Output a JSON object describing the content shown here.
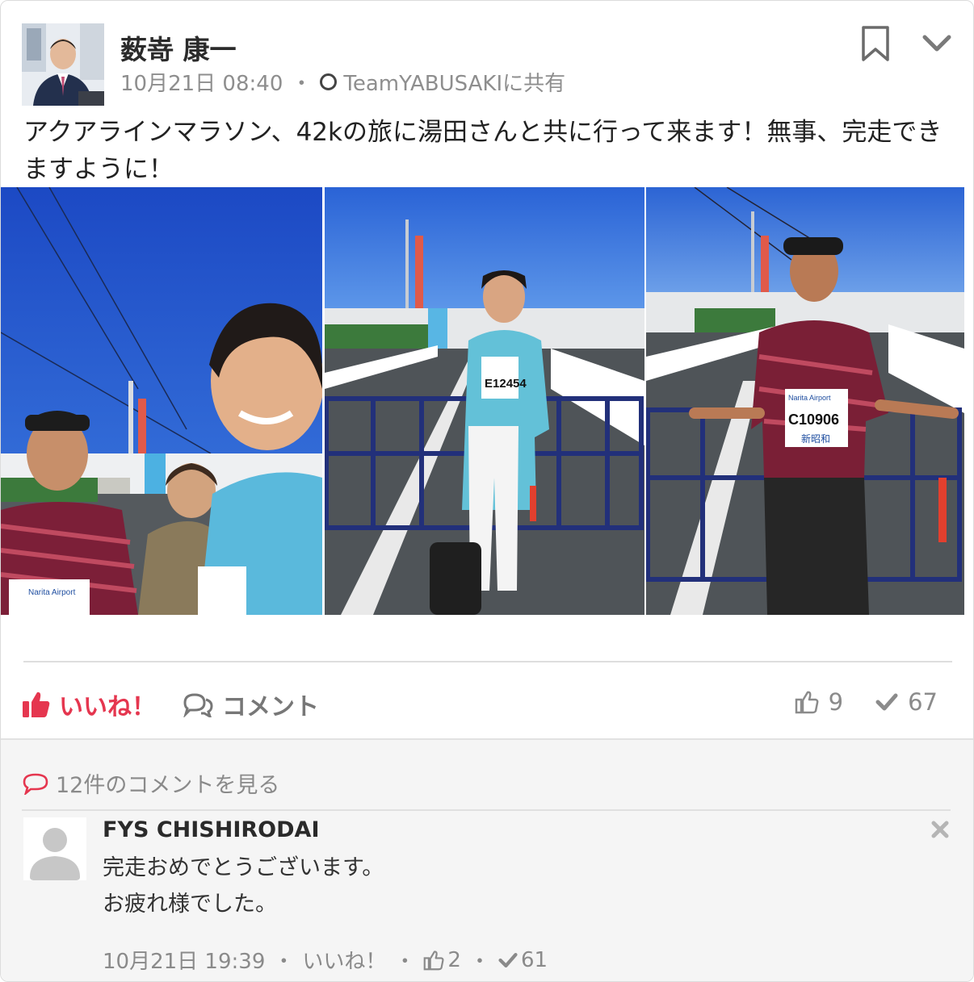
{
  "post": {
    "author": "薮嵜 康一",
    "timestamp": "10月21日 08:40",
    "separator": "・",
    "audience": "TeamYABUSAKIに共有",
    "text": "アクアラインマラソン、42kの旅に湯田さんと共に行って来ます！無事、完走できますように！",
    "bib_1": "E12454",
    "bib_2": "C10906",
    "bib_sponsor": "新昭和",
    "bib_event": "Narita Airport"
  },
  "actions": {
    "like_label": "いいね！",
    "comment_label": "コメント",
    "like_count": "9",
    "check_count": "67"
  },
  "comments": {
    "view_all_label": "12件のコメントを見る",
    "items": [
      {
        "author": "FYS CHISHIRODAI",
        "line1": "完走おめでとうございます。",
        "line2": "お疲れ様でした。",
        "timestamp": "10月21日 19:39",
        "sep": "・",
        "like_label": "いいね！",
        "like_count": "2",
        "check_count": "61"
      }
    ]
  },
  "colors": {
    "accent_red": "#e5364f",
    "sky_blue": "#1f56c8",
    "text_gray": "#8a8a8a"
  },
  "icons": [
    "bookmark-icon",
    "chevron-down-icon",
    "thumbs-up-icon",
    "comment-icon",
    "thumbs-up-outline-icon",
    "check-icon",
    "close-icon",
    "globe-circle-icon"
  ]
}
